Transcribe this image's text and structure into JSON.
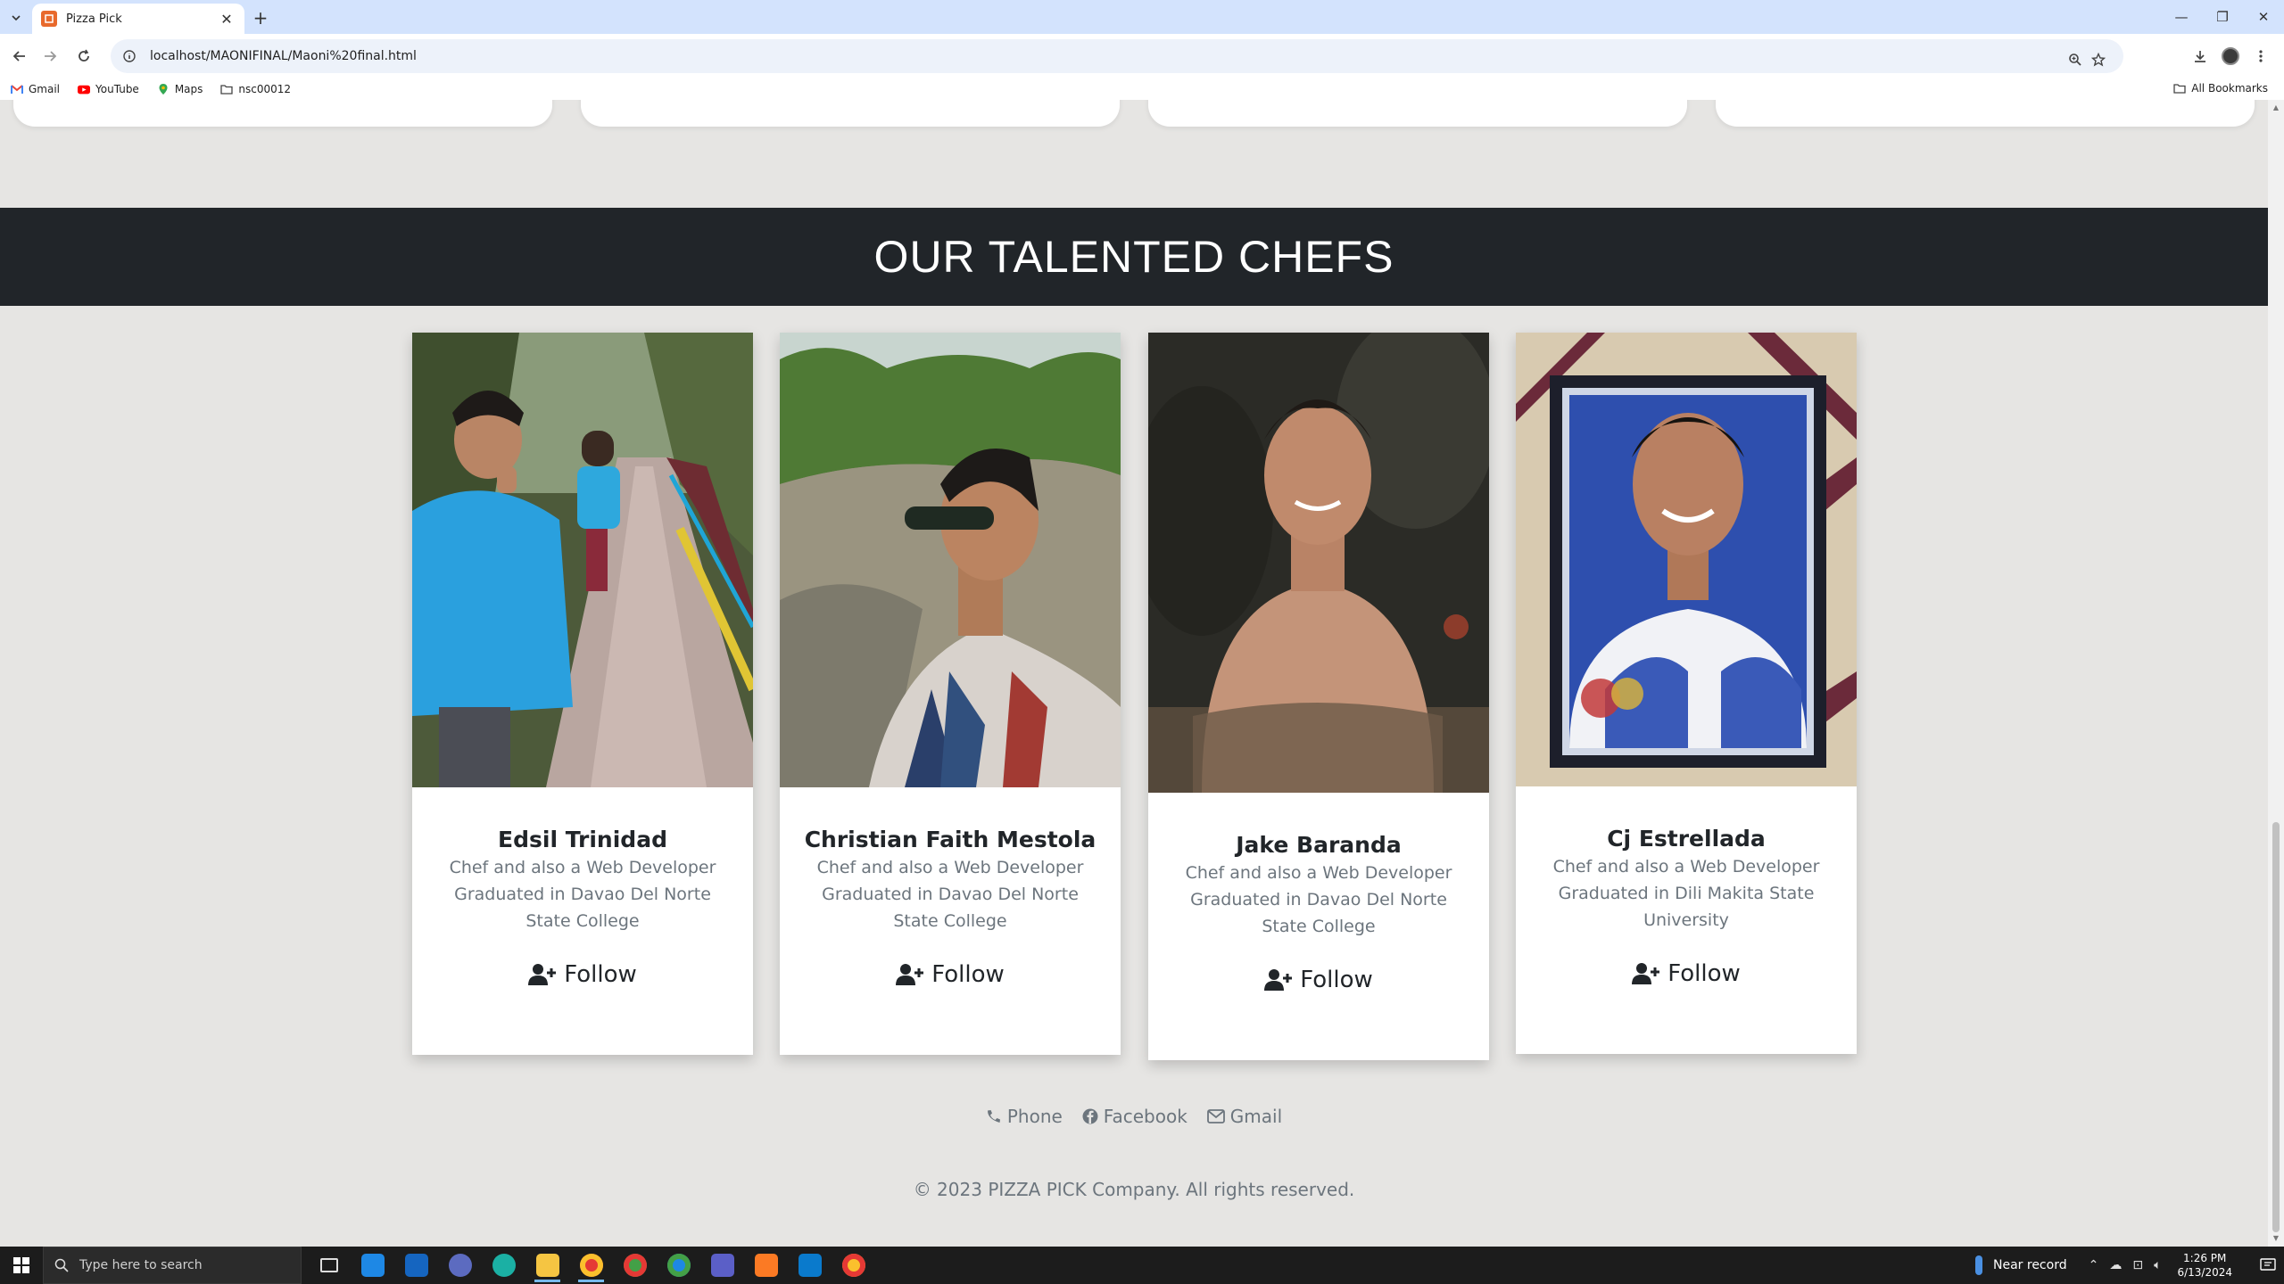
{
  "browser": {
    "tab_title": "Pizza Pick",
    "url": "localhost/MAONIFINAL/Maoni%20final.html",
    "bookmarks": [
      {
        "label": "Gmail",
        "icon": "gmail-icon"
      },
      {
        "label": "YouTube",
        "icon": "youtube-icon"
      },
      {
        "label": "Maps",
        "icon": "maps-icon"
      },
      {
        "label": "nsc00012",
        "icon": "folder-icon"
      }
    ],
    "all_bookmarks": "All Bookmarks"
  },
  "page": {
    "section_title": "OUR TALENTED CHEFS",
    "chefs": [
      {
        "name": "Edsil Trinidad",
        "desc": "Chef and also a Web Developer Graduated in Davao Del Norte State College",
        "follow": "Follow",
        "photo": "photo-bridge"
      },
      {
        "name": "Christian Faith Mestola",
        "desc": "Chef and also a Web Developer Graduated in Davao Del Norte State College",
        "follow": "Follow",
        "photo": "photo-sunglasses"
      },
      {
        "name": "Jake Baranda",
        "desc": "Chef and also a Web Developer Graduated in Davao Del Norte State College",
        "follow": "Follow",
        "photo": "photo-water"
      },
      {
        "name": "Cj Estrellada",
        "desc": "Chef and also a Web Developer Graduated in Dili Makita State University",
        "follow": "Follow",
        "photo": "photo-frame"
      }
    ],
    "footer": {
      "links": [
        {
          "label": "Phone",
          "icon": "phone-icon"
        },
        {
          "label": "Facebook",
          "icon": "facebook-icon"
        },
        {
          "label": "Gmail",
          "icon": "envelope-icon"
        }
      ],
      "copyright": "© 2023 PIZZA PICK Company.  All rights reserved."
    }
  },
  "taskbar": {
    "search_placeholder": "Type here to search",
    "weather": "Near record",
    "time": "1:26 PM",
    "date": "6/13/2024"
  },
  "colors": {
    "banner": "#212529",
    "page_bg": "#e6e5e3",
    "muted_text": "#6c757d",
    "tab_strip": "#d3e3fd"
  }
}
